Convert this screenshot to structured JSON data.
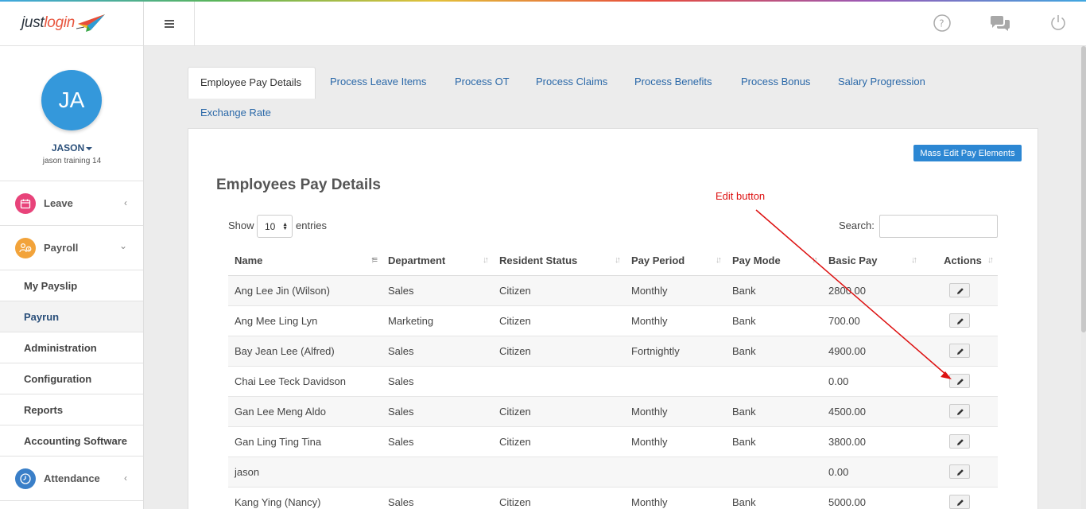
{
  "brand": {
    "logo_part1": "just",
    "logo_part2": "login"
  },
  "user": {
    "initials": "JA",
    "name": "JASON",
    "subtitle": "jason training 14"
  },
  "sidebar": {
    "leave": {
      "label": "Leave",
      "color": "#e8437a"
    },
    "payroll": {
      "label": "Payroll",
      "color": "#f2a33a"
    },
    "sub_items": [
      "My Payslip",
      "Payrun",
      "Administration",
      "Configuration",
      "Reports",
      "Accounting Software"
    ],
    "active_sub": "Payrun",
    "attendance": {
      "label": "Attendance",
      "color": "#3a7fc8"
    }
  },
  "header": {
    "icons": [
      "help-icon",
      "chat-icon",
      "power-icon"
    ]
  },
  "tabs": [
    "Employee Pay Details",
    "Process Leave Items",
    "Process OT",
    "Process Claims",
    "Process Benefits",
    "Process Bonus",
    "Salary Progression",
    "Exchange Rate"
  ],
  "active_tab": "Employee Pay Details",
  "panel": {
    "title": "Employees Pay Details",
    "mass_edit_label": "Mass Edit Pay Elements",
    "show_label": "Show",
    "entries_value": "10",
    "entries_label": "entries",
    "search_label": "Search:",
    "search_value": ""
  },
  "table": {
    "headers": [
      "Name",
      "Department",
      "Resident Status",
      "Pay Period",
      "Pay Mode",
      "Basic Pay",
      "Actions"
    ],
    "rows": [
      [
        "Ang Lee Jin (Wilson)",
        "Sales",
        "Citizen",
        "Monthly",
        "Bank",
        "2800.00"
      ],
      [
        "Ang Mee Ling Lyn",
        "Marketing",
        "Citizen",
        "Monthly",
        "Bank",
        "700.00"
      ],
      [
        "Bay Jean Lee (Alfred)",
        "Sales",
        "Citizen",
        "Fortnightly",
        "Bank",
        "4900.00"
      ],
      [
        "Chai Lee Teck Davidson",
        "Sales",
        "",
        "",
        "",
        "0.00"
      ],
      [
        "Gan Lee Meng Aldo",
        "Sales",
        "Citizen",
        "Monthly",
        "Bank",
        "4500.00"
      ],
      [
        "Gan Ling Ting Tina",
        "Sales",
        "Citizen",
        "Monthly",
        "Bank",
        "3800.00"
      ],
      [
        "jason",
        "",
        "",
        "",
        "",
        "0.00"
      ],
      [
        "Kang Ying (Nancy)",
        "Sales",
        "Citizen",
        "Monthly",
        "Bank",
        "5000.00"
      ]
    ]
  },
  "annotation": {
    "text": "Edit button",
    "color": "#dd1111"
  }
}
